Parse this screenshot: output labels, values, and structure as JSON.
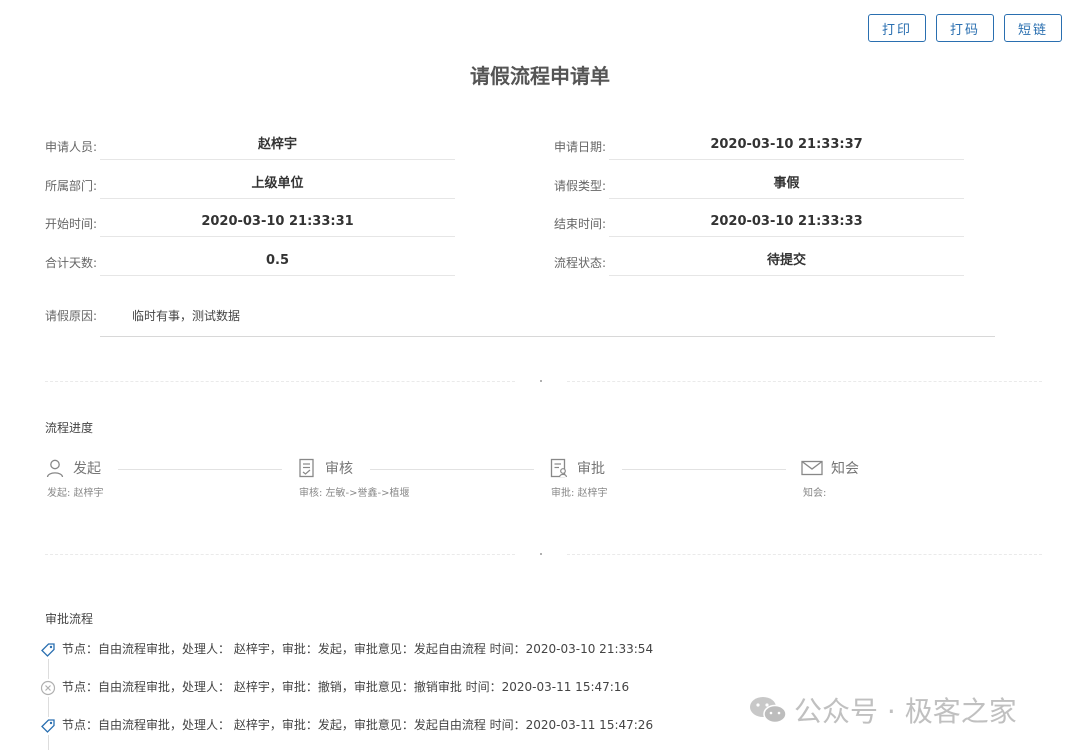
{
  "toolbar": {
    "print": "打印",
    "code": "打码",
    "shortlink": "短链"
  },
  "page_title": "请假流程申请单",
  "form": {
    "rows": [
      {
        "left": {
          "label": "申请人员:",
          "value": "赵梓宇"
        },
        "right": {
          "label": "申请日期:",
          "value": "2020-03-10 21:33:37"
        }
      },
      {
        "left": {
          "label": "所属部门:",
          "value": "上级单位"
        },
        "right": {
          "label": "请假类型:",
          "value": "事假"
        }
      },
      {
        "left": {
          "label": "开始时间:",
          "value": "2020-03-10 21:33:31"
        },
        "right": {
          "label": "结束时间:",
          "value": "2020-03-10 21:33:33"
        }
      },
      {
        "left": {
          "label": "合计天数:",
          "value": "0.5"
        },
        "right": {
          "label": "流程状态:",
          "value": "待提交"
        }
      }
    ],
    "reason": {
      "label": "请假原因:",
      "value": "临时有事，测试数据"
    }
  },
  "progress": {
    "title": "流程进度",
    "steps": [
      {
        "icon": "user-icon",
        "name": "发起",
        "detail": "发起: 赵梓宇"
      },
      {
        "icon": "document-check-icon",
        "name": "审核",
        "detail": "审核: 左敏->誉鑫->植堰"
      },
      {
        "icon": "document-user-icon",
        "name": "审批",
        "detail": "审批: 赵梓宇"
      },
      {
        "icon": "mail-icon",
        "name": "知会",
        "detail": "知会:"
      }
    ]
  },
  "approval": {
    "title": "审批流程",
    "entries": [
      {
        "icon": "tag-icon",
        "text": "节点：自由流程审批，处理人： 赵梓宇，审批：发起，审批意见：发起自由流程 时间：2020-03-10 21:33:54",
        "color": "#2a6fb0"
      },
      {
        "icon": "cancel-icon",
        "text": "节点：自由流程审批，处理人： 赵梓宇，审批：撤销，审批意见：撤销审批 时间：2020-03-11 15:47:16",
        "color": "#b0b0b0"
      },
      {
        "icon": "tag-icon",
        "text": "节点：自由流程审批，处理人： 赵梓宇，审批：发起，审批意见：发起自由流程 时间：2020-03-11 15:47:26",
        "color": "#2a6fb0"
      }
    ]
  },
  "watermark": {
    "text": "公众号 · 极客之家"
  },
  "colors": {
    "accent": "#2a6fb0"
  }
}
